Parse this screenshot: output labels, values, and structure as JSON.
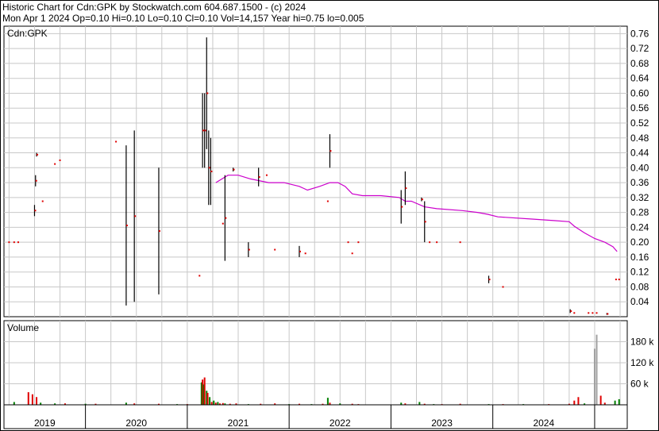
{
  "header": {
    "line1": "Historic Chart for Cdn:GPK by Stockwatch.com 604.687.1500 - (c) 2024",
    "line2": "Mon Apr  1 2024  Op=0.10  Hi=0.10  Lo=0.10  Cl=0.10  Vol=14,157  Year hi=0.75  lo=0.005"
  },
  "colors": {
    "up": "#008000",
    "down": "#e00000",
    "avg": "#cc00cc",
    "volume": "#a0a0a0",
    "grid": "#c8c8c8"
  },
  "chart_data": [
    {
      "type": "line",
      "title": "Cdn:GPK",
      "ylim": [
        0,
        0.78
      ],
      "yticks": [
        "0.04",
        "0.08",
        "0.12",
        "0.16",
        "0.20",
        "0.24",
        "0.28",
        "0.32",
        "0.36",
        "0.40",
        "0.44",
        "0.48",
        "0.52",
        "0.56",
        "0.60",
        "0.64",
        "0.68",
        "0.72",
        "0.76"
      ],
      "grid": true,
      "price_bars": [
        {
          "x": 2018.25,
          "lo": 0.2,
          "hi": 0.2
        },
        {
          "x": 2018.3,
          "lo": 0.2,
          "hi": 0.2
        },
        {
          "x": 2018.34,
          "lo": 0.2,
          "hi": 0.2
        },
        {
          "x": 2018.5,
          "lo": 0.27,
          "hi": 0.3
        },
        {
          "x": 2018.51,
          "lo": 0.35,
          "hi": 0.38
        },
        {
          "x": 2018.52,
          "lo": 0.43,
          "hi": 0.44
        },
        {
          "x": 2018.58,
          "lo": 0.31,
          "hi": 0.31
        },
        {
          "x": 2018.7,
          "lo": 0.41,
          "hi": 0.41
        },
        {
          "x": 2018.75,
          "lo": 0.42,
          "hi": 0.42
        },
        {
          "x": 2019.3,
          "lo": 0.47,
          "hi": 0.47
        },
        {
          "x": 2019.4,
          "lo": 0.03,
          "hi": 0.46
        },
        {
          "x": 2019.48,
          "lo": 0.04,
          "hi": 0.5
        },
        {
          "x": 2019.72,
          "lo": 0.06,
          "hi": 0.4
        },
        {
          "x": 2020.12,
          "lo": 0.11,
          "hi": 0.11
        },
        {
          "x": 2020.15,
          "lo": 0.4,
          "hi": 0.6
        },
        {
          "x": 2020.17,
          "lo": 0.4,
          "hi": 0.6
        },
        {
          "x": 2020.19,
          "lo": 0.45,
          "hi": 0.75
        },
        {
          "x": 2020.21,
          "lo": 0.3,
          "hi": 0.5
        },
        {
          "x": 2020.23,
          "lo": 0.3,
          "hi": 0.48
        },
        {
          "x": 2020.35,
          "lo": 0.25,
          "hi": 0.25
        },
        {
          "x": 2020.37,
          "lo": 0.15,
          "hi": 0.38
        },
        {
          "x": 2020.45,
          "lo": 0.39,
          "hi": 0.4
        },
        {
          "x": 2020.6,
          "lo": 0.16,
          "hi": 0.2
        },
        {
          "x": 2020.7,
          "lo": 0.35,
          "hi": 0.4
        },
        {
          "x": 2020.78,
          "lo": 0.38,
          "hi": 0.38
        },
        {
          "x": 2020.86,
          "lo": 0.18,
          "hi": 0.18
        },
        {
          "x": 2021.1,
          "lo": 0.16,
          "hi": 0.19
        },
        {
          "x": 2021.16,
          "lo": 0.17,
          "hi": 0.17
        },
        {
          "x": 2021.38,
          "lo": 0.31,
          "hi": 0.31
        },
        {
          "x": 2021.4,
          "lo": 0.4,
          "hi": 0.49
        },
        {
          "x": 2021.58,
          "lo": 0.2,
          "hi": 0.2
        },
        {
          "x": 2021.62,
          "lo": 0.17,
          "hi": 0.17
        },
        {
          "x": 2021.68,
          "lo": 0.2,
          "hi": 0.2
        },
        {
          "x": 2022.1,
          "lo": 0.25,
          "hi": 0.34
        },
        {
          "x": 2022.14,
          "lo": 0.3,
          "hi": 0.39
        },
        {
          "x": 2022.3,
          "lo": 0.31,
          "hi": 0.32
        },
        {
          "x": 2022.33,
          "lo": 0.2,
          "hi": 0.31
        },
        {
          "x": 2022.38,
          "lo": 0.2,
          "hi": 0.2
        },
        {
          "x": 2022.45,
          "lo": 0.2,
          "hi": 0.2
        },
        {
          "x": 2022.68,
          "lo": 0.2,
          "hi": 0.2
        },
        {
          "x": 2022.96,
          "lo": 0.09,
          "hi": 0.11
        },
        {
          "x": 2023.1,
          "lo": 0.08,
          "hi": 0.08
        },
        {
          "x": 2023.76,
          "lo": 0.01,
          "hi": 0.02
        },
        {
          "x": 2023.8,
          "lo": 0.01,
          "hi": 0.01
        },
        {
          "x": 2023.94,
          "lo": 0.01,
          "hi": 0.01
        },
        {
          "x": 2023.98,
          "lo": 0.01,
          "hi": 0.01
        },
        {
          "x": 2024.02,
          "lo": 0.01,
          "hi": 0.01
        },
        {
          "x": 2024.12,
          "lo": 0.005,
          "hi": 0.01
        },
        {
          "x": 2024.21,
          "lo": 0.1,
          "hi": 0.1
        },
        {
          "x": 2024.24,
          "lo": 0.1,
          "hi": 0.1
        }
      ],
      "moving_average": {
        "x": [
          2020.28,
          2020.4,
          2020.5,
          2020.62,
          2020.8,
          2020.95,
          2021.1,
          2021.18,
          2021.3,
          2021.4,
          2021.48,
          2021.55,
          2021.62,
          2021.72,
          2021.9,
          2022.08,
          2022.14,
          2022.2,
          2022.33,
          2022.45,
          2022.7,
          2022.85,
          2022.95,
          2023.05,
          2023.4,
          2023.6,
          2023.75,
          2023.8,
          2023.9,
          2024.0,
          2024.1,
          2024.18,
          2024.22
        ],
        "y": [
          0.36,
          0.38,
          0.38,
          0.37,
          0.36,
          0.36,
          0.35,
          0.34,
          0.35,
          0.36,
          0.36,
          0.35,
          0.33,
          0.325,
          0.325,
          0.32,
          0.31,
          0.31,
          0.295,
          0.29,
          0.285,
          0.28,
          0.275,
          0.268,
          0.262,
          0.258,
          0.255,
          0.243,
          0.225,
          0.21,
          0.2,
          0.188,
          0.175
        ]
      }
    },
    {
      "type": "bar",
      "title": "Volume",
      "ylim": [
        0,
        240000
      ],
      "yticks": [
        "60 k",
        "120 k",
        "180 k"
      ],
      "x": [
        2018.3,
        2018.44,
        2018.48,
        2018.52,
        2018.56,
        2018.7,
        2018.8,
        2019.0,
        2019.1,
        2019.4,
        2019.48,
        2019.72,
        2019.9,
        2020.0,
        2020.14,
        2020.15,
        2020.16,
        2020.17,
        2020.19,
        2020.2,
        2020.22,
        2020.24,
        2020.26,
        2020.28,
        2020.3,
        2020.32,
        2020.35,
        2020.37,
        2020.42,
        2020.48,
        2020.6,
        2020.72,
        2020.86,
        2021.0,
        2021.1,
        2021.22,
        2021.33,
        2021.38,
        2021.4,
        2021.5,
        2021.62,
        2021.68,
        2022.1,
        2022.14,
        2022.28,
        2022.33,
        2022.42,
        2022.5,
        2022.68,
        2022.96,
        2023.1,
        2023.3,
        2023.55,
        2023.75,
        2023.8,
        2023.84,
        2023.9,
        2024.0,
        2024.02,
        2024.06,
        2024.1,
        2024.2,
        2024.24
      ],
      "values": [
        8000,
        36000,
        30000,
        22000,
        6000,
        4000,
        4000,
        3000,
        3000,
        6000,
        4000,
        3000,
        2000,
        2000,
        64000,
        72000,
        58000,
        78000,
        40000,
        34000,
        22000,
        8000,
        12000,
        6000,
        8000,
        4000,
        5000,
        4000,
        3000,
        4000,
        2000,
        3000,
        4000,
        2000,
        3000,
        2000,
        3000,
        20000,
        6000,
        4000,
        3000,
        2000,
        6000,
        4000,
        8000,
        3000,
        2000,
        2000,
        3000,
        2000,
        2000,
        2000,
        2000,
        3000,
        12000,
        22000,
        4000,
        160000,
        200000,
        26000,
        6000,
        12000,
        16000
      ],
      "up": [
        true,
        false,
        false,
        false,
        true,
        true,
        false,
        true,
        false,
        true,
        false,
        false,
        true,
        false,
        true,
        false,
        true,
        false,
        true,
        false,
        true,
        false,
        true,
        false,
        true,
        false,
        false,
        true,
        false,
        false,
        true,
        false,
        false,
        true,
        false,
        true,
        false,
        true,
        false,
        true,
        false,
        false,
        true,
        false,
        true,
        false,
        true,
        false,
        false,
        true,
        false,
        true,
        false,
        false,
        false,
        false,
        true,
        false,
        false,
        false,
        false,
        true,
        true
      ]
    }
  ],
  "x_axis": {
    "years": [
      "2019",
      "2020",
      "2021",
      "2022",
      "2023",
      "2024"
    ],
    "year_positions": [
      2019.0,
      2020.0,
      2021.0,
      2022.0,
      2023.0,
      2024.0
    ],
    "xlim": [
      2018.2,
      2024.32
    ]
  }
}
